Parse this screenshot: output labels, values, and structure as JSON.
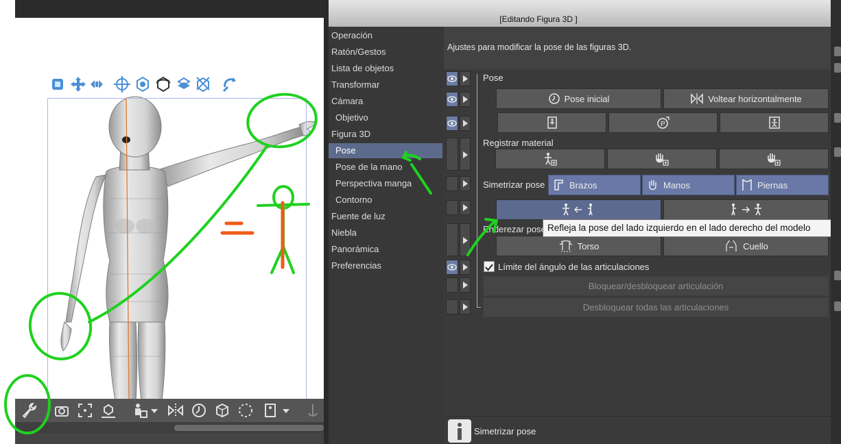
{
  "preview": {
    "label": "[Editando Figura 3D ]"
  },
  "categories": [
    {
      "label": "Operación",
      "level": "top"
    },
    {
      "label": "Ratón/Gestos",
      "level": "top"
    },
    {
      "label": "Lista de objetos",
      "level": "top"
    },
    {
      "label": "Transformar",
      "level": "top"
    },
    {
      "label": "Cámara",
      "level": "top"
    },
    {
      "label": "Objetivo",
      "level": "sub"
    },
    {
      "label": "Figura 3D",
      "level": "top"
    },
    {
      "label": "Pose",
      "level": "sub",
      "selected": true
    },
    {
      "label": "Pose de la mano",
      "level": "sub"
    },
    {
      "label": "Perspectiva manga",
      "level": "sub"
    },
    {
      "label": "Contorno",
      "level": "sub"
    },
    {
      "label": "Fuente de luz",
      "level": "top"
    },
    {
      "label": "Niebla",
      "level": "top"
    },
    {
      "label": "Panorámica",
      "level": "top"
    },
    {
      "label": "Preferencias",
      "level": "top"
    }
  ],
  "description": "Ajustes para modificar la pose de las figuras 3D.",
  "sections": {
    "pose": {
      "label": "Pose",
      "initial_pose": "Pose inicial",
      "flip_horizontal": "Voltear horizontalmente"
    },
    "register": {
      "label": "Registrar material"
    },
    "symmetrize": {
      "label": "Simetrizar pose",
      "arms": "Brazos",
      "hands": "Manos",
      "legs": "Piernas"
    },
    "straighten": {
      "label": "Enderezar pose",
      "torso": "Torso",
      "neck": "Cuello"
    },
    "joint_limit": {
      "label": "Límite del ángulo de las articulaciones",
      "checked": true
    },
    "lock_joint": "Bloquear/desbloquear articulación",
    "unlock_all": "Desbloquear todas las articulaciones"
  },
  "tooltip": "Refleja la pose del lado izquierdo en el lado derecho del modelo",
  "status": {
    "text": "Simetrizar pose"
  },
  "annotations": {
    "equals_sign": "="
  },
  "colors": {
    "panel_bg": "#3d3d3d",
    "selected": "#5c6b8c",
    "accent_blue": "#6978a6",
    "annotation_green": "#1fd11f",
    "annotation_orange": "#f05a1a"
  }
}
